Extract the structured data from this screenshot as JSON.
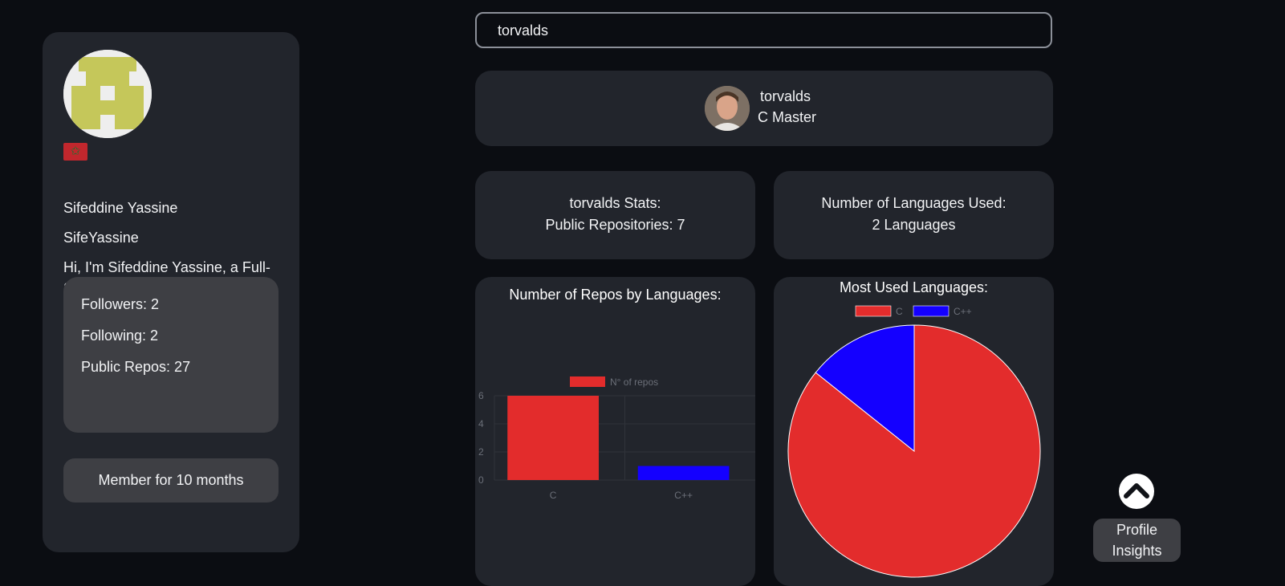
{
  "profile": {
    "country_flag": "Morocco flag",
    "name": "Sifeddine Yassine",
    "login": "SifeYassine",
    "bio": "Hi, I'm Sifeddine Yassine, a Full-Stack Developer 😊",
    "followers": "Followers: 2",
    "following": "Following: 2",
    "public_repos": "Public Repos: 27",
    "member_since": "Member for 10 months"
  },
  "search": {
    "value": "torvalds"
  },
  "user": {
    "login": "torvalds",
    "title": "C Master"
  },
  "repo_stats": {
    "line1": "torvalds Stats:",
    "line2": "Public Repositories: 7"
  },
  "lang_stats": {
    "line1": "Number of Languages Used:",
    "line2": "2 Languages"
  },
  "insights_button": {
    "line1": "Profile",
    "line2": "Insights"
  },
  "colors": {
    "c": "#e32c2c",
    "cpp": "#1400ff",
    "card": "#22252c"
  },
  "chart_data": [
    {
      "type": "bar",
      "title": "Number of Repos by Languages:",
      "categories": [
        "C",
        "C++"
      ],
      "series": [
        {
          "name": "N° of repos",
          "values": [
            6,
            1
          ]
        }
      ],
      "ylim": [
        0,
        6
      ],
      "yticks": [
        0,
        2,
        4,
        6
      ],
      "legend": "top",
      "grid": true
    },
    {
      "type": "pie",
      "title": "Most Used Languages:",
      "labels": [
        "C",
        "C++"
      ],
      "values": [
        6,
        1
      ],
      "legend": "top"
    }
  ]
}
